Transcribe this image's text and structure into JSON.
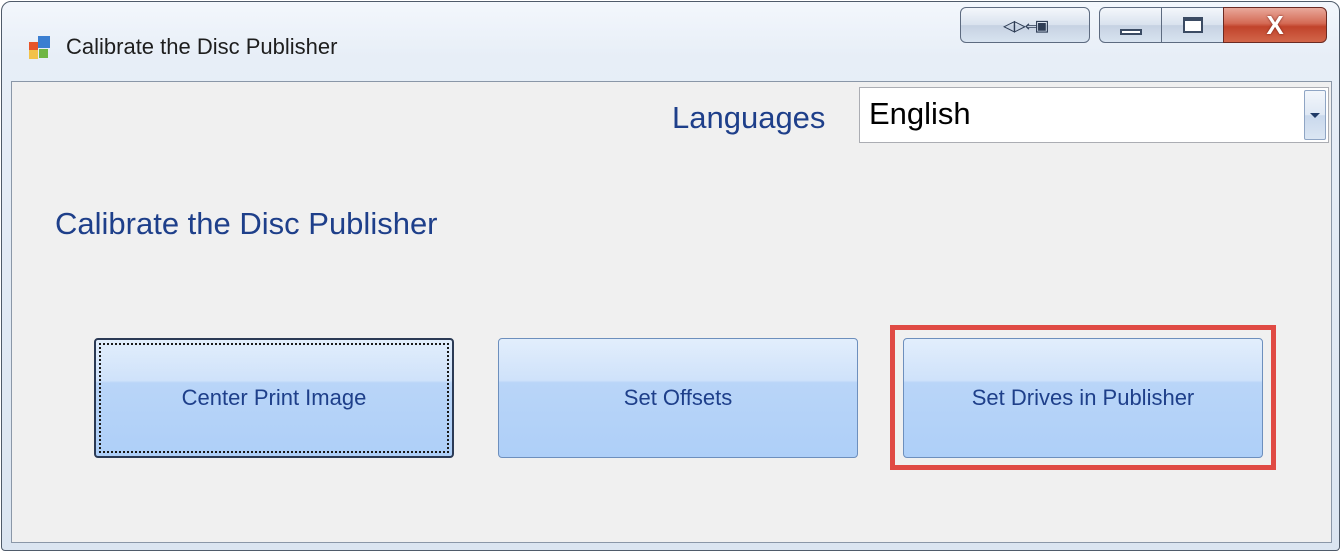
{
  "window": {
    "title": "Calibrate the Disc Publisher",
    "icon": "app-window-icon",
    "caption_buttons": {
      "extra_icon": "dock-toggle-icon",
      "minimize_icon": "minimize-icon",
      "maximize_icon": "maximize-icon",
      "close_icon": "close-icon",
      "close_glyph": "X"
    }
  },
  "language": {
    "label": "Languages",
    "selected": "English",
    "dropdown_icon": "chevron-down-icon"
  },
  "heading": "Calibrate the Disc Publisher",
  "buttons": [
    {
      "label": "Center Print Image"
    },
    {
      "label": "Set Offsets"
    },
    {
      "label": "Set Drives in Publisher"
    }
  ],
  "colors": {
    "text_blue": "#1e3f8a",
    "highlight": "#e04a44",
    "button_fill": "#b9d5f8"
  }
}
